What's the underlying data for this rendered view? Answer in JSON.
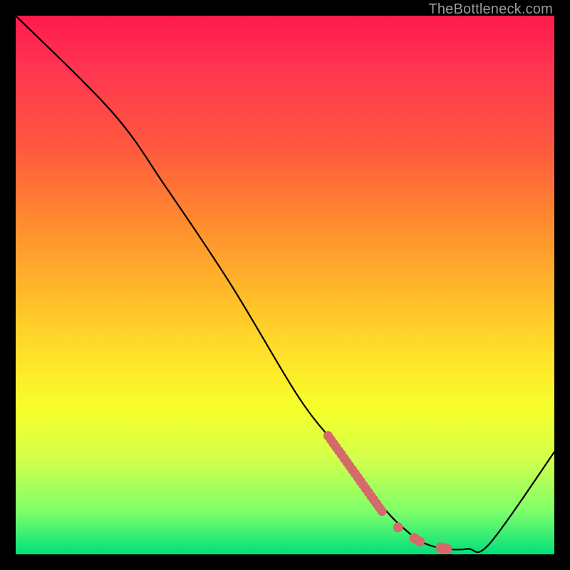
{
  "watermark": "TheBottleneck.com",
  "chart_data": {
    "type": "line",
    "title": "",
    "xlabel": "",
    "ylabel": "",
    "xlim": [
      0,
      100
    ],
    "ylim": [
      0,
      100
    ],
    "series": [
      {
        "name": "curve",
        "x": [
          0,
          18,
          28,
          40,
          52,
          58,
          60,
          68,
          73,
          76,
          80,
          84,
          88,
          100
        ],
        "y": [
          100,
          82,
          68,
          50,
          30,
          22,
          20,
          9,
          4,
          2,
          1,
          1,
          2,
          19
        ]
      }
    ],
    "markers": {
      "name": "highlighted-points",
      "color": "#d46a6a",
      "points": [
        {
          "x": 58,
          "y": 22,
          "r": 3.0
        },
        {
          "x": 58.5,
          "y": 21.3,
          "r": 3.0
        },
        {
          "x": 59,
          "y": 20.6,
          "r": 3.0
        },
        {
          "x": 59.5,
          "y": 19.9,
          "r": 3.0
        },
        {
          "x": 60,
          "y": 19.2,
          "r": 3.0
        },
        {
          "x": 60.5,
          "y": 18.5,
          "r": 3.0
        },
        {
          "x": 61,
          "y": 17.8,
          "r": 3.0
        },
        {
          "x": 61.5,
          "y": 17.1,
          "r": 3.0
        },
        {
          "x": 62,
          "y": 16.4,
          "r": 3.0
        },
        {
          "x": 62.5,
          "y": 15.7,
          "r": 3.0
        },
        {
          "x": 63,
          "y": 15.0,
          "r": 3.0
        },
        {
          "x": 63.5,
          "y": 14.3,
          "r": 3.0
        },
        {
          "x": 64,
          "y": 13.6,
          "r": 3.0
        },
        {
          "x": 64.5,
          "y": 12.9,
          "r": 3.0
        },
        {
          "x": 65,
          "y": 12.2,
          "r": 3.0
        },
        {
          "x": 65.5,
          "y": 11.5,
          "r": 3.0
        },
        {
          "x": 66,
          "y": 10.8,
          "r": 3.0
        },
        {
          "x": 66.5,
          "y": 10.1,
          "r": 3.0
        },
        {
          "x": 67,
          "y": 9.4,
          "r": 3.0
        },
        {
          "x": 67.5,
          "y": 8.7,
          "r": 3.0
        },
        {
          "x": 68,
          "y": 8.0,
          "r": 3.0
        },
        {
          "x": 71,
          "y": 5.0,
          "r": 3.2
        },
        {
          "x": 74,
          "y": 3.0,
          "r": 3.2
        },
        {
          "x": 75,
          "y": 2.4,
          "r": 3.2
        },
        {
          "x": 79,
          "y": 1.2,
          "r": 3.5
        },
        {
          "x": 80,
          "y": 1.0,
          "r": 3.5
        }
      ]
    }
  }
}
